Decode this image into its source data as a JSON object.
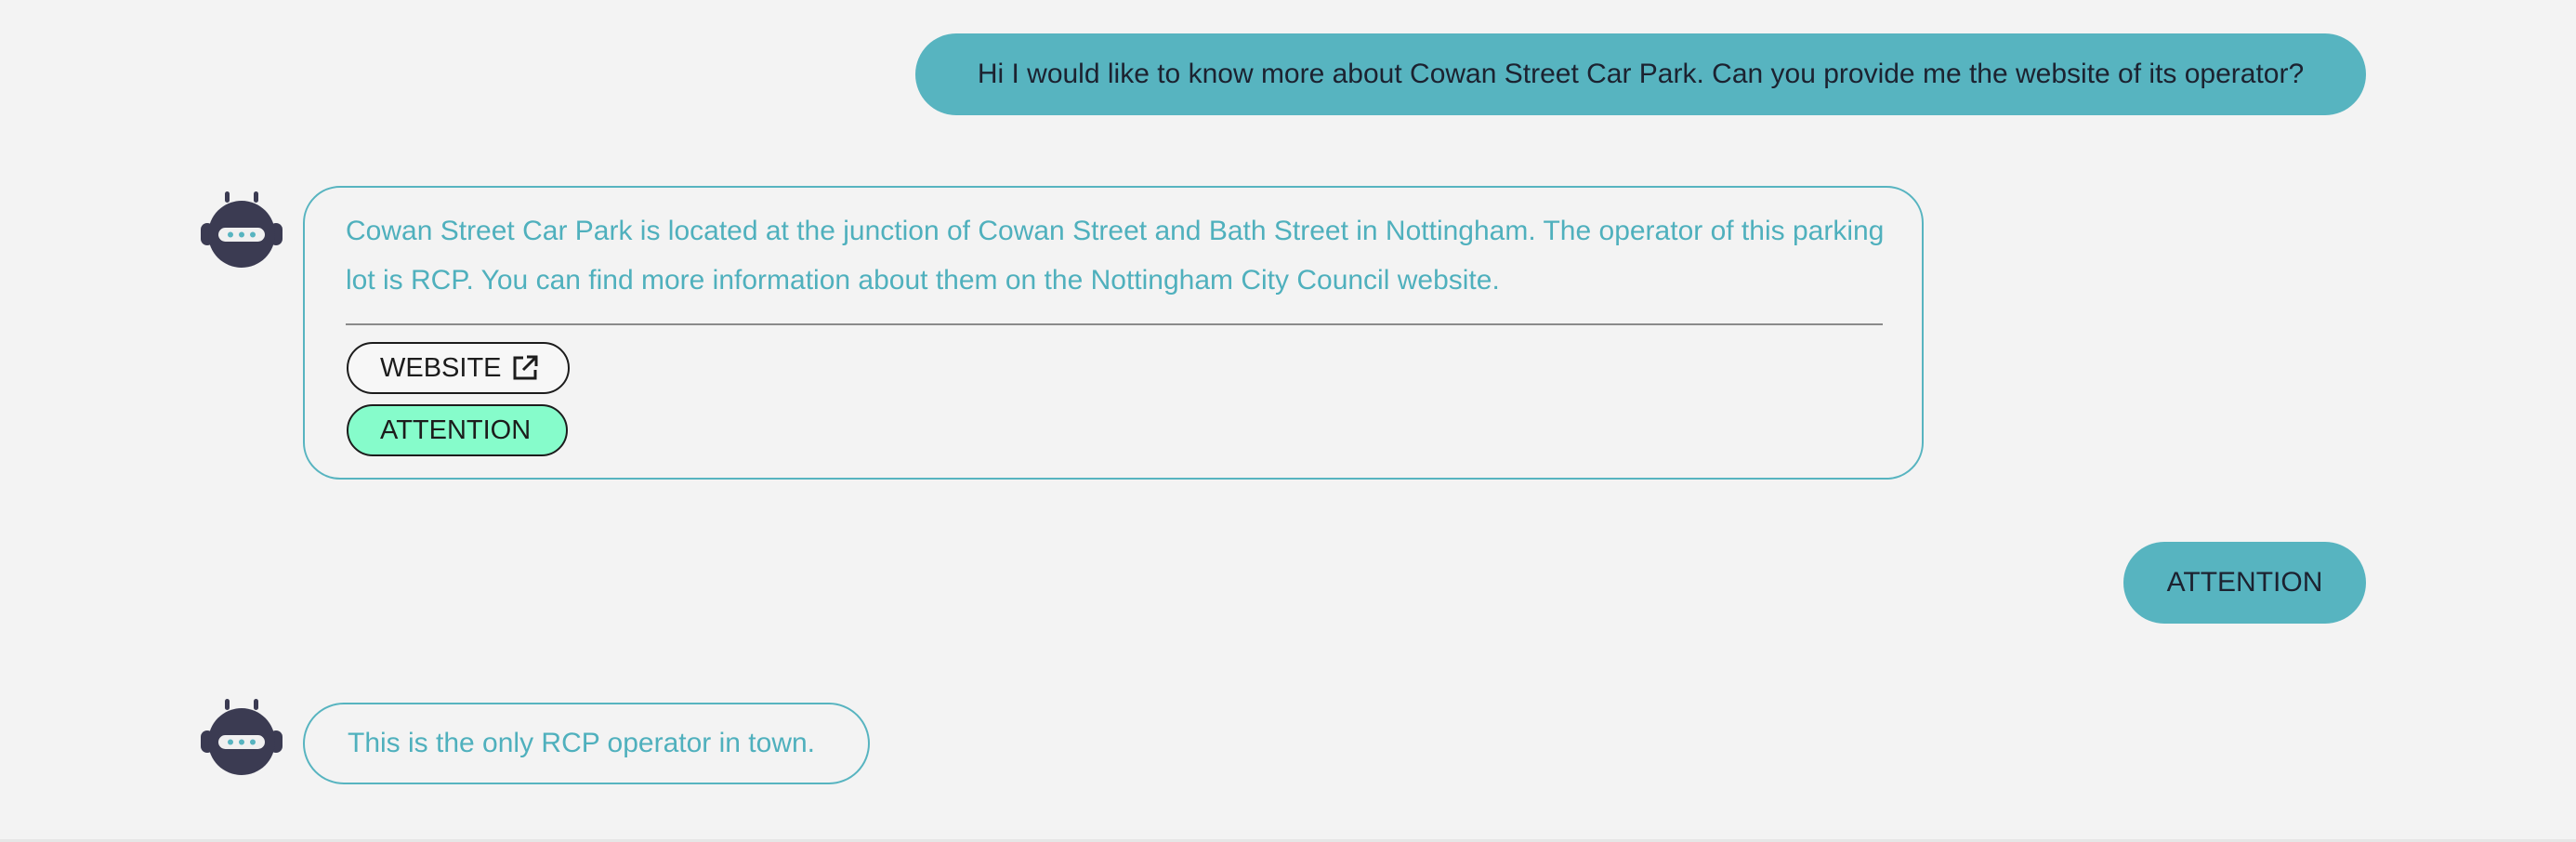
{
  "messages": {
    "user_1": "Hi I would like to know more about Cowan Street Car Park. Can you provide me the website of its operator?",
    "bot_1": {
      "text": "Cowan Street Car Park is located at the junction of Cowan Street and Bath Street in Nottingham. The operator of this parking lot is RCP. You can find more information about them on the Nottingham City Council website.",
      "buttons": {
        "website_label": "WEBSITE",
        "attention_label": "ATTENTION"
      }
    },
    "user_2": "ATTENTION",
    "bot_2": "This is the only RCP operator in town."
  },
  "icons": {
    "avatar": "robot-icon",
    "external_link": "external-link-icon"
  },
  "colors": {
    "background": "#f3f3f3",
    "user_bubble": "#57b4c0",
    "bot_text": "#4fb0bd",
    "bot_border": "#57b4c0",
    "attention_button": "#86fccb",
    "avatar": "#3b3b52"
  }
}
